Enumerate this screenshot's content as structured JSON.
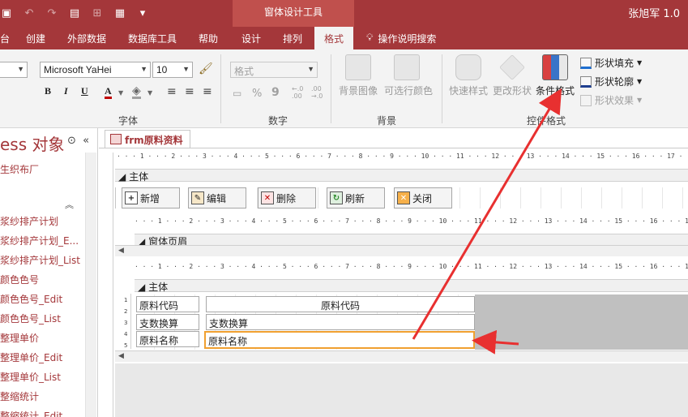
{
  "window": {
    "tools_title": "窗体设计工具",
    "user": "张旭军 1.0"
  },
  "tabs": [
    "台",
    "创建",
    "外部数据",
    "数据库工具",
    "帮助",
    "设计",
    "排列",
    "格式"
  ],
  "search_tab": "操作说明搜索",
  "ribbon": {
    "font_group": {
      "label": "字体",
      "font_name": "Microsoft YaHei",
      "font_size": "10",
      "bold": "B",
      "italic": "I",
      "underline": "U",
      "font_color_glyph": "A"
    },
    "number_group": {
      "label": "数字",
      "format_placeholder": "格式",
      "percent": "%",
      "comma": "9"
    },
    "background_group": {
      "label": "背景",
      "bg_image": "背景图像",
      "alt_row_color": "可选行颜色"
    },
    "control_format_group": {
      "label": "控件格式",
      "quick_styles": "快速样式",
      "change_shape": "更改形状",
      "conditional_format": "条件格式",
      "shape_fill": "形状填充",
      "shape_outline": "形状轮廓",
      "shape_effects": "形状效果"
    }
  },
  "nav": {
    "title": "ess 对象",
    "sub": "生织布厂",
    "items": [
      "浆纱排产计划",
      "浆纱排产计划_E...",
      "浆纱排产计划_List",
      "颜色色号",
      "颜色色号_Edit",
      "颜色色号_List",
      "整理单价",
      "整理单价_Edit",
      "整理单价_List",
      "整缩统计",
      "整缩统计_Edit"
    ]
  },
  "document": {
    "tab_label": "frm原料资料",
    "ruler_marks": "· · · 1 · · · 2 · · · 3 · · · 4 · · · 5 · · · 6 · · · 7 · · · 8 · · · 9 · · · 10 · · · 11 · · · 12 · · · 13 · · · 14 · · · 15 · · · 16 · · · 17 · · · 18",
    "section_main": "主体",
    "section_form_header": "窗体页眉",
    "section_main2": "主体",
    "buttons": [
      {
        "label": "新增",
        "icon": "new-record-icon"
      },
      {
        "label": "编辑",
        "icon": "edit-icon"
      },
      {
        "label": "删除",
        "icon": "delete-icon"
      },
      {
        "label": "刷新",
        "icon": "refresh-icon"
      },
      {
        "label": "关闭",
        "icon": "close-icon"
      }
    ],
    "fields": {
      "code_label": "原料代码",
      "code_value": "原料代码",
      "count_label": "支数换算",
      "count_value": "支数换算",
      "name_label": "原料名称",
      "name_value": "原料名称"
    },
    "vruler_marks": [
      "1",
      "2",
      "3",
      "4",
      "5"
    ]
  },
  "colors": {
    "brand": "#a4373a",
    "annotation_arrow": "#e83030",
    "selection": "#f0a030"
  }
}
